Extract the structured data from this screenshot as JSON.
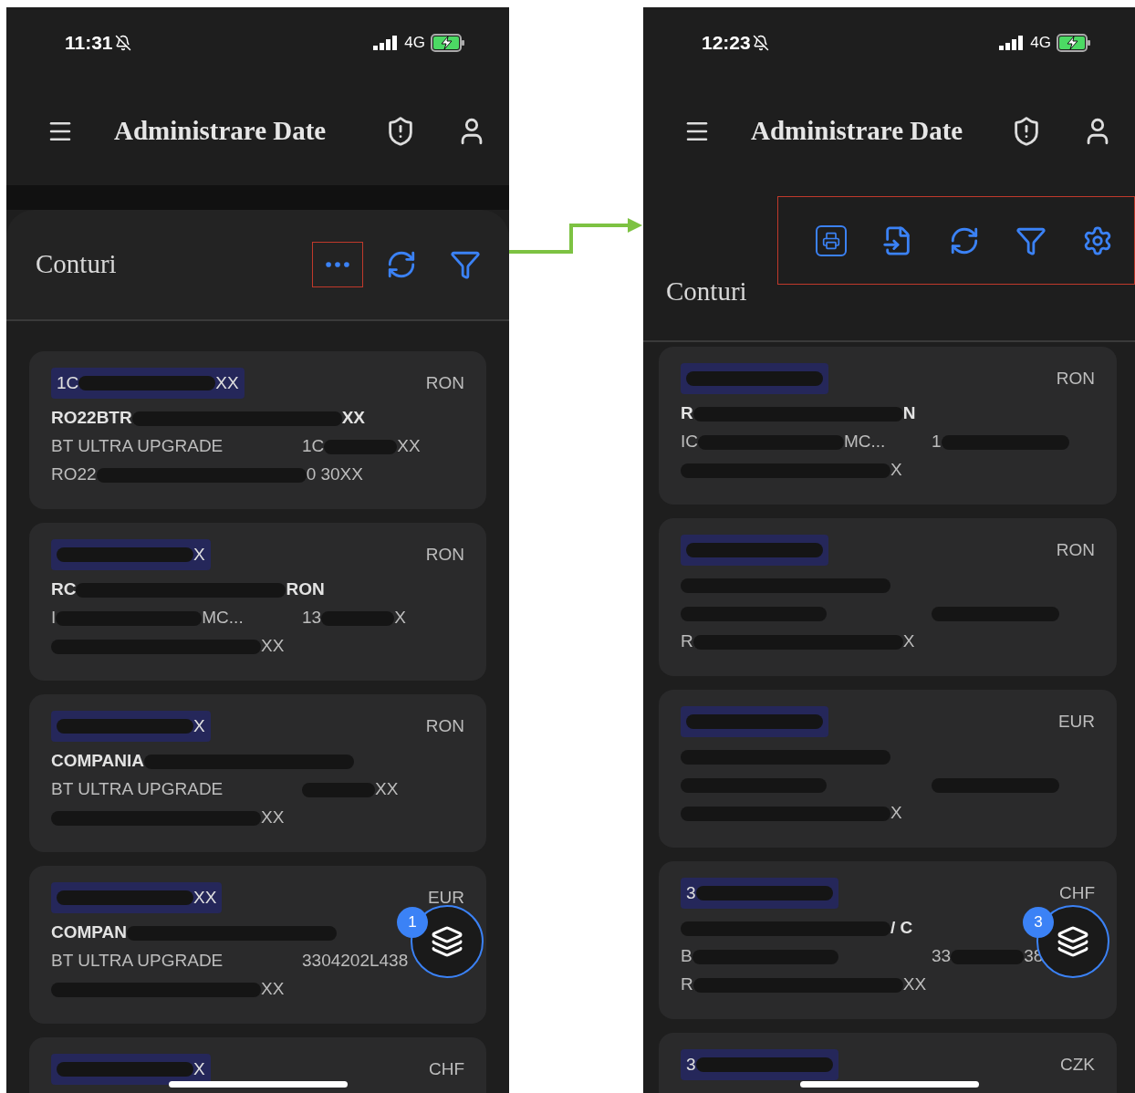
{
  "phones": [
    {
      "status": {
        "time": "11:31",
        "network": "4G"
      },
      "header": {
        "title": "Administrare Date"
      },
      "section": {
        "kind": "compact",
        "title": "Conturi",
        "actions_framed": false,
        "actions": [
          {
            "kind": "more",
            "framed": true
          },
          {
            "kind": "refresh",
            "framed": false
          },
          {
            "kind": "filter",
            "framed": false
          }
        ]
      },
      "cards": [
        {
          "id": {
            "before": "1C",
            "after": "XX",
            "redacted": true
          },
          "currency": "RON",
          "title": {
            "before": "RO22BTR",
            "after": "XX",
            "redacted": true
          },
          "product": {
            "before": "BT ULTRA UPGRADE"
          },
          "account": {
            "before": "1C",
            "after": "XX",
            "redacted": true
          },
          "iban": {
            "before": "RO22",
            "after": "0 30XX",
            "redacted": true
          }
        },
        {
          "id": {
            "after": "X",
            "redacted": true
          },
          "currency": "RON",
          "title": {
            "before": "RC",
            "after": "RON",
            "redacted": true
          },
          "product": {
            "before": "I",
            "after": "MC...",
            "redacted": true
          },
          "account": {
            "before": "13",
            "after": "X",
            "redacted": true
          },
          "iban": {
            "after": "XX",
            "redacted": true
          }
        },
        {
          "id": {
            "after": "X",
            "redacted": true
          },
          "currency": "RON",
          "title": {
            "before": "COMPANIA",
            "redacted": true
          },
          "product": {
            "before": "BT ULTRA UPGRADE"
          },
          "account": {
            "after": "XX",
            "redacted": true
          },
          "iban": {
            "after": "XX",
            "redacted": true
          }
        },
        {
          "id": {
            "after": "XX",
            "redacted": true
          },
          "currency": "EUR",
          "title": {
            "before": "COMPAN",
            "redacted": true
          },
          "product": {
            "before": "BT ULTRA UPGRADE"
          },
          "account": {
            "before": "3304202L438"
          },
          "iban": {
            "after": "XX",
            "redacted": true
          }
        },
        {
          "id": {
            "after": "X",
            "redacted": true
          },
          "currency": "CHF"
        }
      ],
      "fab": {
        "badge": "1"
      }
    },
    {
      "status": {
        "time": "12:23",
        "network": "4G"
      },
      "header": {
        "title": "Administrare Date"
      },
      "section": {
        "kind": "expanded",
        "title": "Conturi",
        "actions_framed": true,
        "actions": [
          {
            "kind": "print",
            "framed": false
          },
          {
            "kind": "import",
            "framed": false
          },
          {
            "kind": "refresh",
            "framed": false
          },
          {
            "kind": "filter",
            "framed": false
          },
          {
            "kind": "settings",
            "framed": false
          }
        ]
      },
      "cards": [
        {
          "id": {
            "redacted": true
          },
          "currency": "RON",
          "title": {
            "before": "R",
            "after": "N",
            "redacted": true
          },
          "product": {
            "before": "IC",
            "after": "MC...",
            "redacted": true
          },
          "account": {
            "before": "1",
            "redacted": true
          },
          "iban": {
            "after": "X",
            "redacted": true
          }
        },
        {
          "id": {
            "redacted": true
          },
          "currency": "RON",
          "title": {
            "redacted": true
          },
          "product": {
            "redacted": true
          },
          "account": {
            "redacted": true
          },
          "iban": {
            "before": "R",
            "after": "X",
            "redacted": true
          }
        },
        {
          "id": {
            "redacted": true
          },
          "currency": "EUR",
          "title": {
            "redacted": true
          },
          "product": {
            "redacted": true
          },
          "account": {
            "redacted": true
          },
          "iban": {
            "after": "X",
            "redacted": true
          }
        },
        {
          "id": {
            "before": "3",
            "redacted": true
          },
          "currency": "CHF",
          "title": {
            "after": "/ C",
            "redacted": true
          },
          "product": {
            "before": "B",
            "redacted": true
          },
          "account": {
            "before": "33",
            "after": "38",
            "redacted": true
          },
          "iban": {
            "before": "R",
            "after": "XX",
            "redacted": true
          }
        },
        {
          "id": {
            "before": "3",
            "redacted": true
          },
          "currency": "CZK"
        }
      ],
      "fab": {
        "badge": "3"
      }
    }
  ]
}
